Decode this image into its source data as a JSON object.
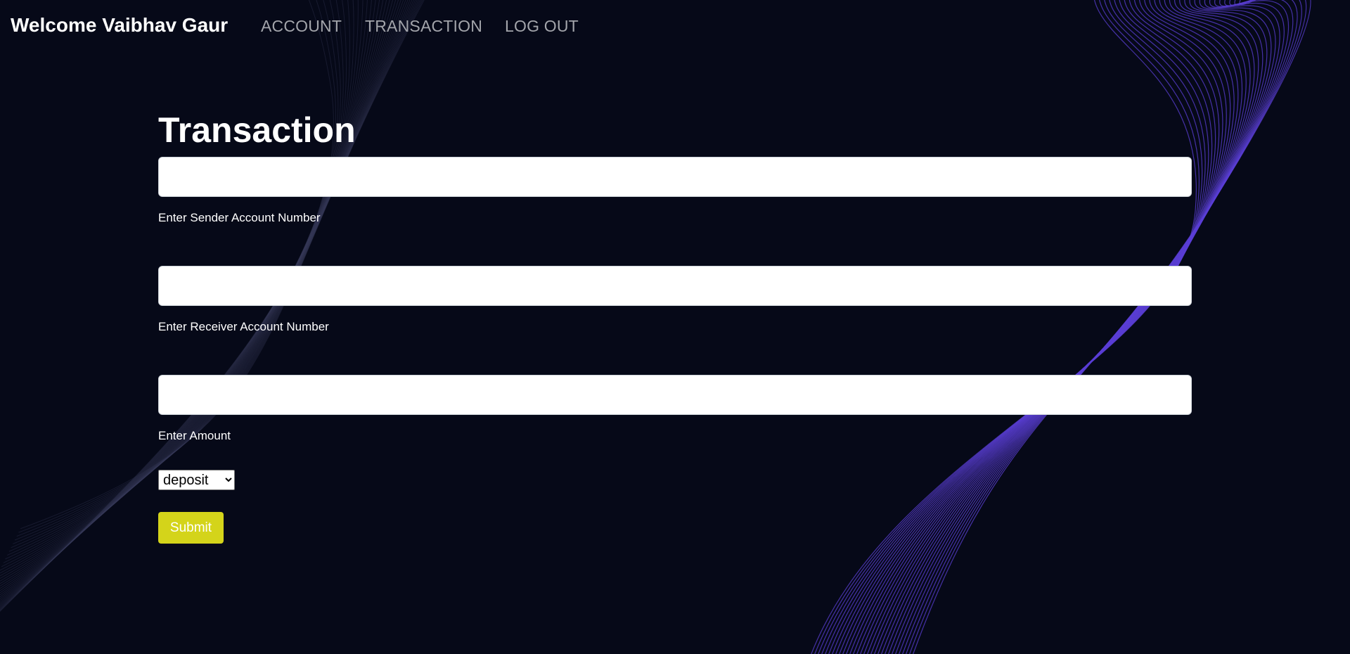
{
  "navbar": {
    "brand": "Welcome Vaibhav Gaur",
    "links": [
      {
        "label": "ACCOUNT"
      },
      {
        "label": "TRANSACTION"
      },
      {
        "label": "LOG OUT"
      }
    ]
  },
  "form": {
    "title": "Transaction",
    "sender": {
      "label": "Enter Sender Account Number",
      "value": "",
      "placeholder": ""
    },
    "receiver": {
      "label": "Enter Receiver Account Number",
      "value": "",
      "placeholder": ""
    },
    "amount": {
      "label": "Enter Amount",
      "value": "",
      "placeholder": ""
    },
    "type_select": {
      "selected": "deposit"
    },
    "submit_label": "Submit"
  },
  "colors": {
    "background": "#060918",
    "accent_button": "#d4d41a",
    "nav_link": "#a3a5ab",
    "wave_purple": "#5b3fd6"
  }
}
